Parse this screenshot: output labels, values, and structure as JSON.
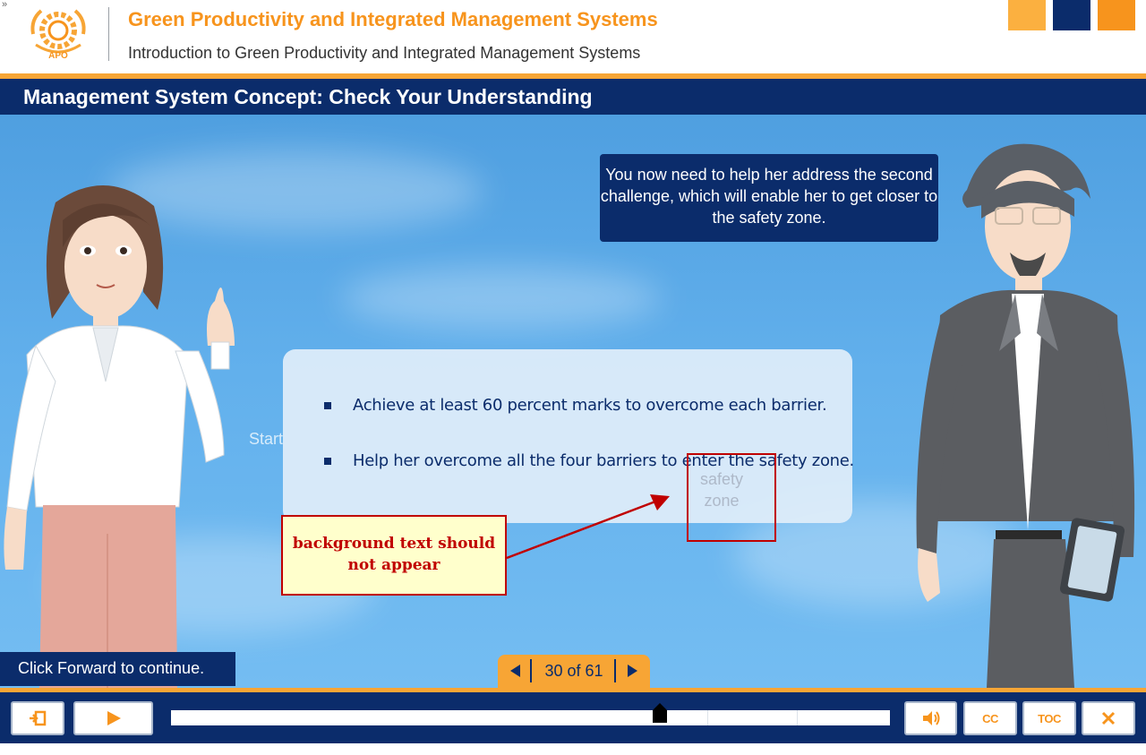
{
  "window": {
    "corner_glyph": "»"
  },
  "header": {
    "logo_text": "APO",
    "course_title": "Green Productivity and Integrated Management Systems",
    "course_subtitle": "Introduction to Green Productivity and Integrated Management Systems",
    "brand_colors": [
      "#fbb040",
      "#0b2c6b",
      "#f7941d"
    ]
  },
  "slide": {
    "title": "Management System Concept: Check Your Understanding",
    "speech_bubble": "You now need to help her address the second challenge, which will enable her to get closer to the safety zone.",
    "background_start_label": "Start",
    "instructions": [
      "Achieve at least 60 percent marks to overcome each barrier.",
      "Help her overcome all the four barriers to enter the safety zone."
    ],
    "background_zone_label": [
      "safety",
      "zone"
    ],
    "annotation": "background text should not appear",
    "hint": "Click Forward to continue."
  },
  "pager": {
    "current": 30,
    "total": 61,
    "label": "30 of 61"
  },
  "player": {
    "buttons": [
      {
        "name": "exit-button",
        "icon": "exit-icon"
      },
      {
        "name": "play-button",
        "icon": "play-icon"
      },
      {
        "name": "volume-button",
        "icon": "volume-icon"
      },
      {
        "name": "captions-button",
        "label": "CC"
      },
      {
        "name": "toc-button",
        "label": "TOC"
      },
      {
        "name": "close-button",
        "icon": "close-icon"
      }
    ],
    "progress_fraction": 0.68
  },
  "colors": {
    "navy": "#0b2c6b",
    "orange": "#f7941d",
    "light_orange": "#f7a535",
    "annotation_red": "#c00000"
  }
}
